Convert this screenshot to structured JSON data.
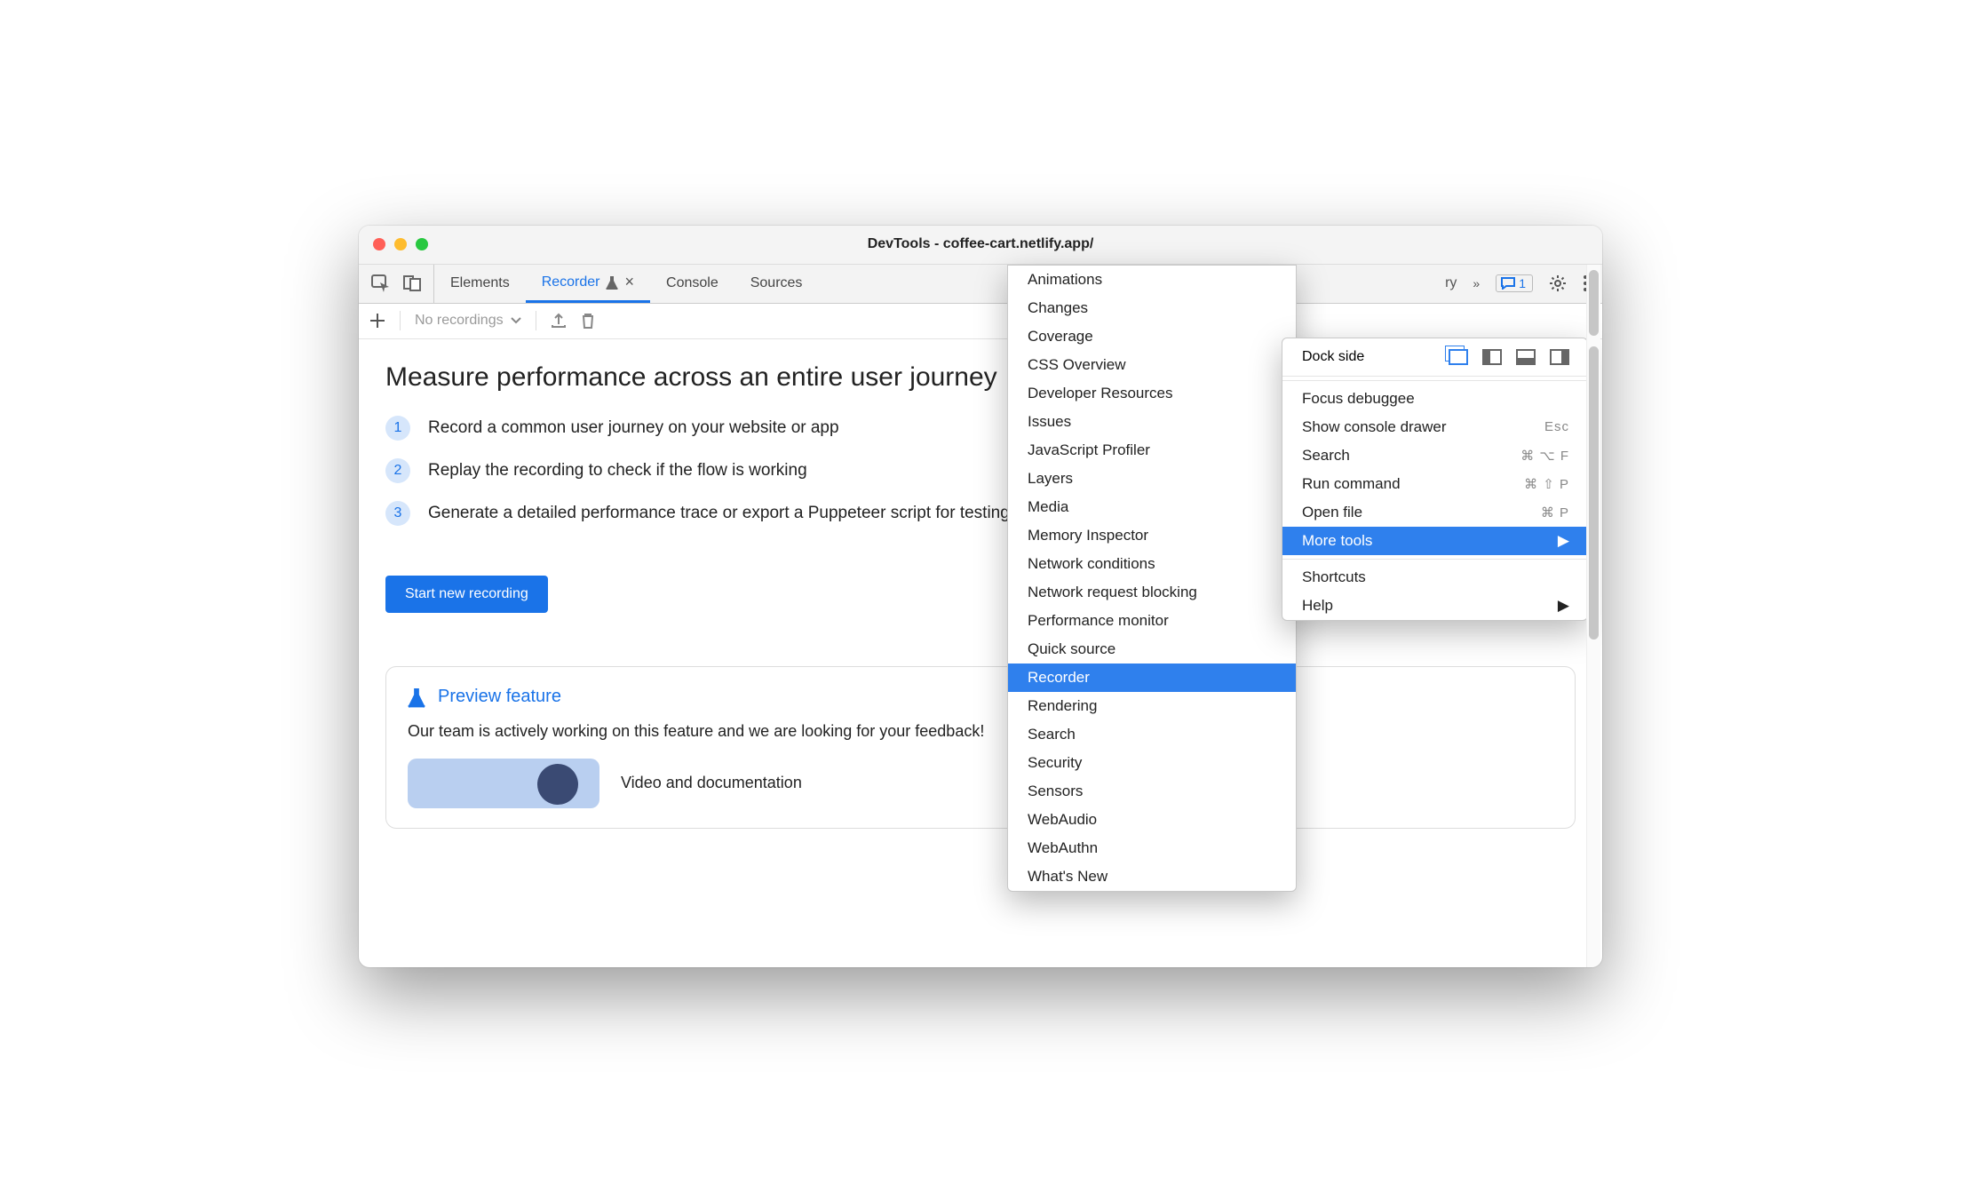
{
  "window_title": "DevTools - coffee-cart.netlify.app/",
  "tabs": [
    "Elements",
    "Recorder",
    "Console",
    "Sources"
  ],
  "hidden_tab_hint": "ry",
  "issues_count": "1",
  "toolbar": {
    "dropdown_placeholder": "No recordings"
  },
  "recorder": {
    "heading": "Measure performance across an entire user journey",
    "steps": [
      "Record a common user journey on your website or app",
      "Replay the recording to check if the flow is working",
      "Generate a detailed performance trace or export a Puppeteer script for testing"
    ],
    "cta": "Start new recording",
    "preview_title": "Preview feature",
    "preview_copy": "Our team is actively working on this feature and we are looking for your feedback!",
    "video_label": "Video and documentation"
  },
  "more_tools_menu": [
    "Animations",
    "Changes",
    "Coverage",
    "CSS Overview",
    "Developer Resources",
    "Issues",
    "JavaScript Profiler",
    "Layers",
    "Media",
    "Memory Inspector",
    "Network conditions",
    "Network request blocking",
    "Performance monitor",
    "Quick source",
    "Recorder",
    "Rendering",
    "Search",
    "Security",
    "Sensors",
    "WebAudio",
    "WebAuthn",
    "What's New"
  ],
  "main_menu": {
    "dock_label": "Dock side",
    "items": [
      {
        "label": "Focus debuggee",
        "shortcut": ""
      },
      {
        "label": "Show console drawer",
        "shortcut": "Esc"
      },
      {
        "label": "Search",
        "shortcut": "⌘ ⌥ F"
      },
      {
        "label": "Run command",
        "shortcut": "⌘ ⇧ P"
      },
      {
        "label": "Open file",
        "shortcut": "⌘ P"
      }
    ],
    "more_tools": "More tools",
    "after": [
      {
        "label": "Shortcuts",
        "shortcut": ""
      },
      {
        "label": "Help",
        "shortcut": "",
        "submenu": true
      }
    ]
  }
}
